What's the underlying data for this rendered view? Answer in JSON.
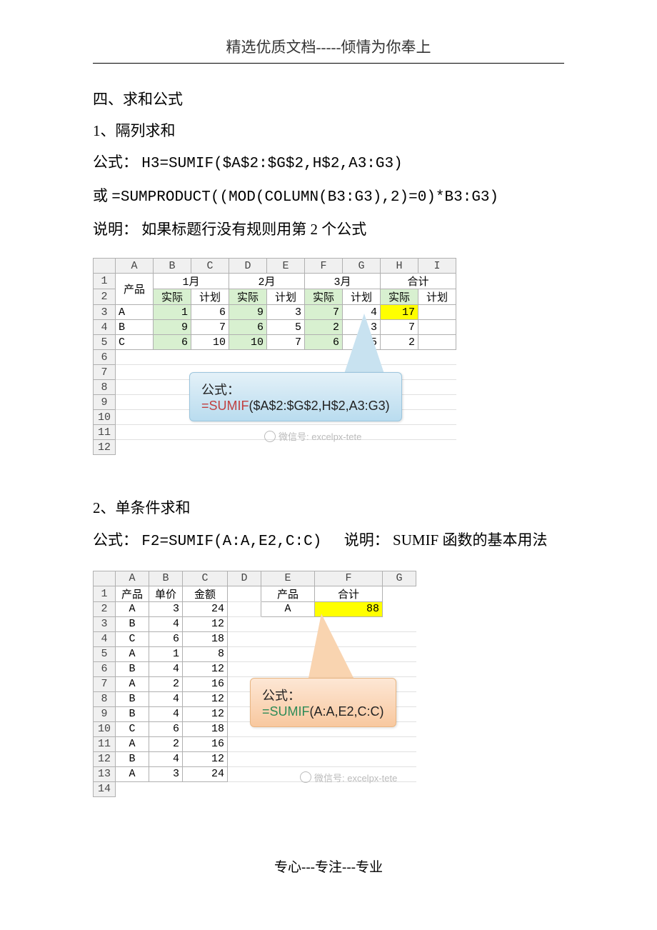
{
  "header": "精选优质文档-----倾情为你奉上",
  "footer": "专心---专注---专业",
  "section_title": "四、求和公式",
  "part1": {
    "title": "1、隔列求和",
    "formula_label": "公式：",
    "formula1": "H3=SUMIF($A$2:$G$2,H$2,A3:G3)",
    "or_label": "或",
    "formula2": "=SUMPRODUCT((MOD(COLUMN(B3:G3),2)=0)*B3:G3)",
    "note_label": "说明：",
    "note": "如果标题行没有规则用第 2 个公式"
  },
  "part2": {
    "title": "2、单条件求和",
    "formula_label": "公式：",
    "formula": "F2=SUMIF(A:A,E2,C:C)",
    "note_label": "说明：",
    "note": "SUMIF 函数的基本用法"
  },
  "fig1": {
    "cols": [
      "A",
      "B",
      "C",
      "D",
      "E",
      "F",
      "G",
      "H",
      "I"
    ],
    "rows_count": 12,
    "header1": {
      "A": "产品",
      "BC": "1月",
      "DE": "2月",
      "FG": "3月",
      "HI": "合计"
    },
    "header2": [
      "实际",
      "计划",
      "实际",
      "计划",
      "实际",
      "计划",
      "实际",
      "计划"
    ],
    "data": [
      {
        "p": "A",
        "v": [
          1,
          6,
          9,
          3,
          7,
          4,
          17,
          ""
        ]
      },
      {
        "p": "B",
        "v": [
          9,
          7,
          6,
          5,
          2,
          3,
          7,
          ""
        ]
      },
      {
        "p": "C",
        "v": [
          6,
          10,
          10,
          7,
          6,
          5,
          2,
          ""
        ]
      }
    ],
    "callout_label": "公式：",
    "callout_formula_fn": "=SUMIF",
    "callout_formula_args": "($A$2:$G$2,H$2,A3:G3)",
    "watermark": "微信号: excelpx-tete"
  },
  "fig2": {
    "cols": [
      "A",
      "B",
      "C",
      "D",
      "E",
      "F",
      "G"
    ],
    "rows_count": 14,
    "header": [
      "产品",
      "单价",
      "金额",
      "",
      "产品",
      "合计",
      ""
    ],
    "row2": {
      "e": "A",
      "f": 88
    },
    "data": [
      {
        "p": "A",
        "u": 3,
        "a": 24
      },
      {
        "p": "B",
        "u": 4,
        "a": 12
      },
      {
        "p": "C",
        "u": 6,
        "a": 18
      },
      {
        "p": "A",
        "u": 1,
        "a": 8
      },
      {
        "p": "B",
        "u": 4,
        "a": 12
      },
      {
        "p": "A",
        "u": 2,
        "a": 16
      },
      {
        "p": "B",
        "u": 4,
        "a": 12
      },
      {
        "p": "B",
        "u": 4,
        "a": 12
      },
      {
        "p": "C",
        "u": 6,
        "a": 18
      },
      {
        "p": "A",
        "u": 2,
        "a": 16
      },
      {
        "p": "B",
        "u": 4,
        "a": 12
      },
      {
        "p": "A",
        "u": 3,
        "a": 24
      }
    ],
    "callout_label": "公式：",
    "callout_formula_fn": "=SUMIF",
    "callout_formula_args": "(A:A,E2,C:C)",
    "watermark": "微信号: excelpx-tete"
  }
}
